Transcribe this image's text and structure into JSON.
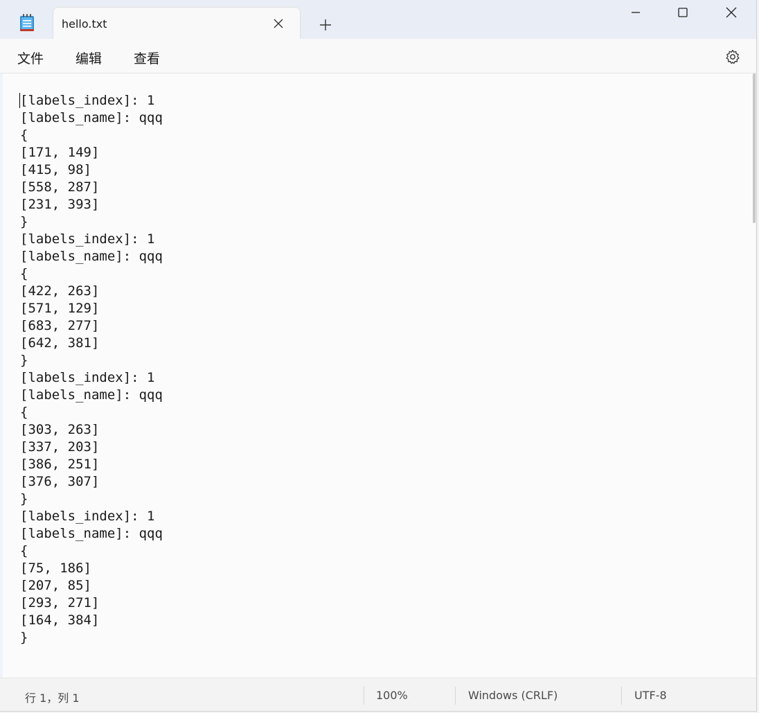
{
  "tab": {
    "title": "hello.txt"
  },
  "menu": {
    "file": "文件",
    "edit": "编辑",
    "view": "查看"
  },
  "editor": {
    "content": "[labels_index]: 1\n[labels_name]: qqq\n{\n[171, 149]\n[415, 98]\n[558, 287]\n[231, 393]\n}\n[labels_index]: 1\n[labels_name]: qqq\n{\n[422, 263]\n[571, 129]\n[683, 277]\n[642, 381]\n}\n[labels_index]: 1\n[labels_name]: qqq\n{\n[303, 263]\n[337, 203]\n[386, 251]\n[376, 307]\n}\n[labels_index]: 1\n[labels_name]: qqq\n{\n[75, 186]\n[207, 85]\n[293, 271]\n[164, 384]\n}"
  },
  "status": {
    "position": "行 1，列 1",
    "zoom": "100%",
    "line_ending": "Windows (CRLF)",
    "encoding": "UTF-8"
  },
  "icons": {
    "app": "notepad-icon",
    "close_tab": "close-icon",
    "new_tab": "plus-icon",
    "minimize": "minimize-icon",
    "maximize": "maximize-icon",
    "close_window": "close-icon",
    "settings": "gear-icon"
  },
  "colors": {
    "app_icon_accent": "#1f8ad2"
  }
}
